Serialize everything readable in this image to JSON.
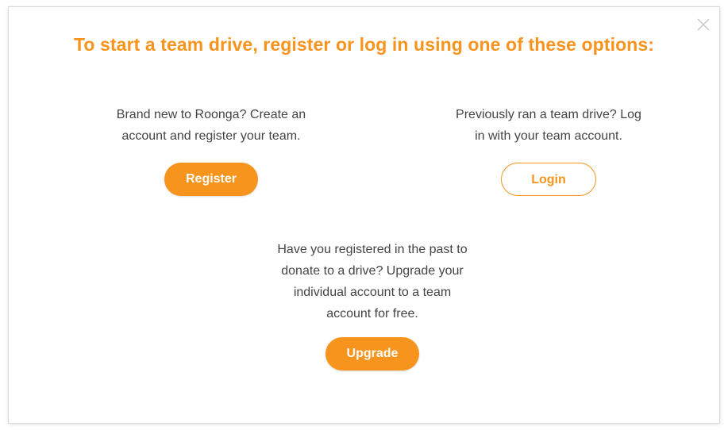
{
  "dialog": {
    "title": "To start a team drive, register or log in using one of these options:",
    "close_icon": "close-icon"
  },
  "options": {
    "register": {
      "line1": "Brand new to Roonga? Create an",
      "line2": "account and register your team.",
      "button_label": "Register"
    },
    "login": {
      "line1": "Previously ran a team drive? Log",
      "line2": "in with your team account.",
      "button_label": "Login"
    },
    "upgrade": {
      "line1": "Have you registered in the past to",
      "line2": "donate to a drive? Upgrade your",
      "line3": "individual account to a team",
      "line4": "account for free.",
      "button_label": "Upgrade"
    }
  },
  "colors": {
    "accent": "#f7941d",
    "text": "#444444",
    "close_icon": "#c8c8c8"
  }
}
